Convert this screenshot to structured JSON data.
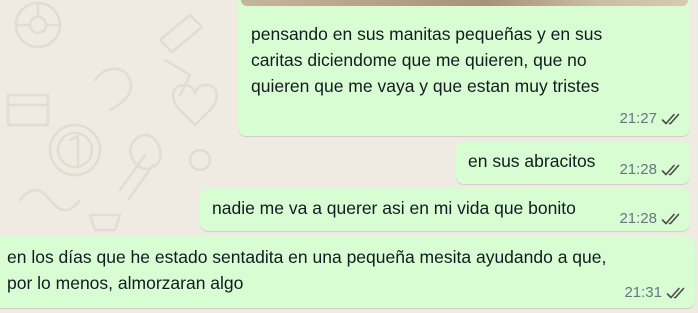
{
  "chat": {
    "background_color": "#efeae2",
    "bubble_color": "#d9fdd3",
    "messages": [
      {
        "text": "pensando en sus manitas pequeñas y en sus\ncaritas diciendome que me quieren, que no\nquieren que me vaya y que estan muy tristes",
        "time": "21:27",
        "status_icon": "double-check-icon"
      },
      {
        "text": "en sus abracitos",
        "time": "21:28",
        "status_icon": "double-check-icon"
      },
      {
        "text": "nadie me va a querer asi en mi vida que bonito",
        "time": "21:28",
        "status_icon": "double-check-icon"
      },
      {
        "text": "en los días que he estado sentadita en una pequeña mesita ayudando a que,\npor lo menos, almorzaran algo",
        "time": "21:31",
        "status_icon": "double-check-icon"
      }
    ]
  }
}
